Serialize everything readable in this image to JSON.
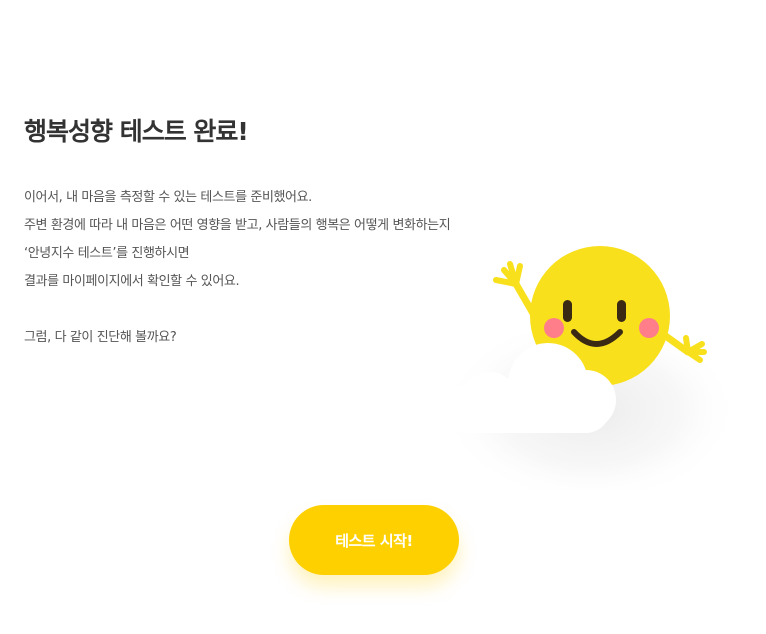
{
  "result": {
    "title": "행복성향 테스트 완료!",
    "description_lines": [
      "이어서, 내 마음을 측정할 수 있는 테스트를 준비했어요.",
      "주변 환경에 따라 내 마음은 어떤 영향을 받고, 사람들의 행복은 어떻게 변화하는지",
      "‘안녕지수 테스트’를 진행하시면",
      "결과를 마이페이지에서 확인할 수 있어요."
    ],
    "question": "그럼, 다 같이 진단해 볼까요?"
  },
  "start_button": {
    "label": "테스트 시작!"
  },
  "colors": {
    "accent": "#ffd000",
    "sun": "#f9e01c",
    "cheek": "#ff7e8a",
    "text": "#333333"
  },
  "illustration": {
    "icon": "smiling-sun-with-cloud-icon"
  }
}
